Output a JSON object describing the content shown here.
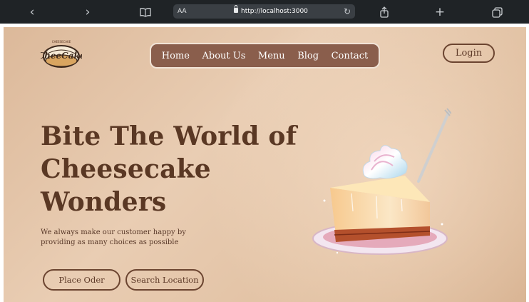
{
  "browser": {
    "back_glyph": "‹",
    "forward_glyph": "›",
    "text_size_label": "AA",
    "url": "http://localhost:3000",
    "reload_glyph": "↻",
    "share_glyph": "⇧",
    "new_tab_glyph": "+",
    "tabs_glyph": "⧉"
  },
  "logo": {
    "text": "CheeCake",
    "arc_text": "CHEESECAKE"
  },
  "nav": {
    "links": [
      "Home",
      "About Us",
      "Menu",
      "Blog",
      "Contact"
    ]
  },
  "header": {
    "login_label": "Login"
  },
  "hero": {
    "title": "Bite The World of Cheesecake Wonders",
    "subtitle": "We always make our customer happy by providing as many choices as possible",
    "cta_primary": "Place Oder",
    "cta_secondary": "Search Location"
  },
  "colors": {
    "brand_brown": "#5a3824",
    "nav_bg": "#8a5e4c",
    "browser_chrome": "#1f2326"
  }
}
